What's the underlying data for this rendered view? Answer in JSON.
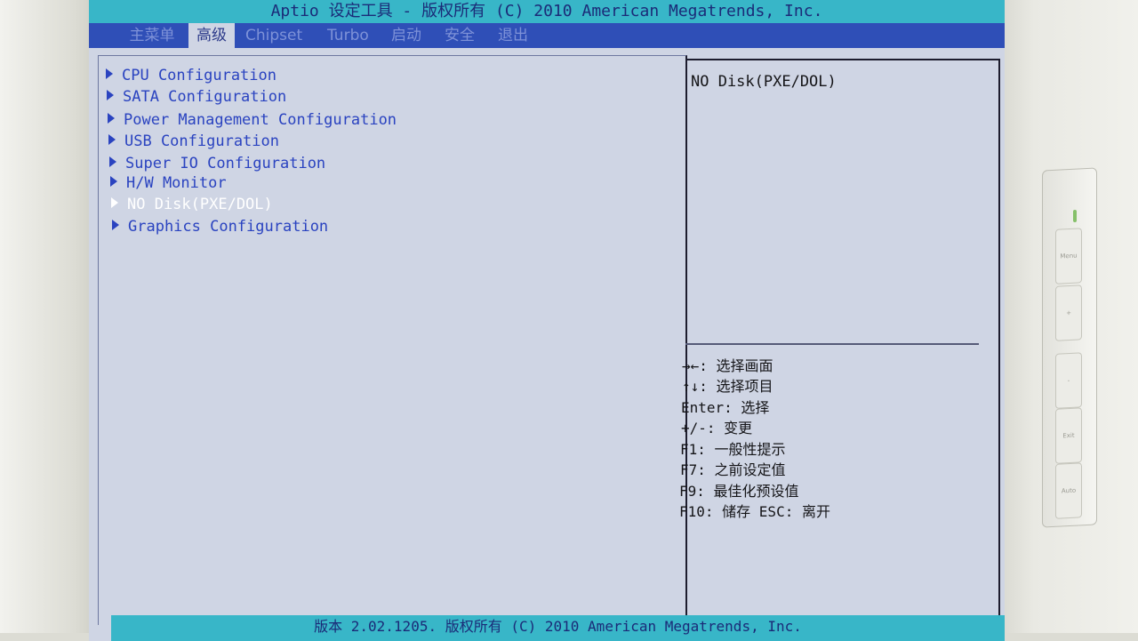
{
  "title": "Aptio 设定工具 - 版权所有 (C) 2010 American Megatrends, Inc.",
  "tabs": [
    {
      "label": "主菜单",
      "active": false
    },
    {
      "label": "高级",
      "active": true
    },
    {
      "label": "Chipset",
      "active": false
    },
    {
      "label": "Turbo",
      "active": false
    },
    {
      "label": "启动",
      "active": false
    },
    {
      "label": "安全",
      "active": false
    },
    {
      "label": "退出",
      "active": false
    }
  ],
  "menu_items": [
    {
      "label": "CPU Configuration"
    },
    {
      "label": "SATA Configuration"
    },
    {
      "label": "Power Management Configuration"
    },
    {
      "label": "USB Configuration"
    },
    {
      "label": "Super IO Configuration"
    },
    {
      "label": "H/W Monitor"
    },
    {
      "label": "NO Disk(PXE/DOL)",
      "selected": true
    },
    {
      "label": "Graphics Configuration"
    }
  ],
  "help": {
    "description": "NO Disk(PXE/DOL)",
    "keys": [
      "→←: 选择画面",
      "↑↓: 选择项目",
      "Enter: 选择",
      "+/-: 变更",
      "F1: 一般性提示",
      "F7: 之前设定值",
      "F9: 最佳化预设值",
      "F10: 储存  ESC: 离开"
    ]
  },
  "footer": "版本 2.02.1205. 版权所有 (C) 2010 American Megatrends, Inc.",
  "monitor": {
    "buttons": [
      "Menu",
      "+",
      "-",
      "Exit",
      "Auto"
    ]
  },
  "colors": {
    "screen_bg": "#cfd5e4",
    "title_bar": "#38b6c8",
    "menu_bar": "#2f4fb7",
    "item_text": "#2a43c0",
    "selected_text": "#ffffff"
  }
}
